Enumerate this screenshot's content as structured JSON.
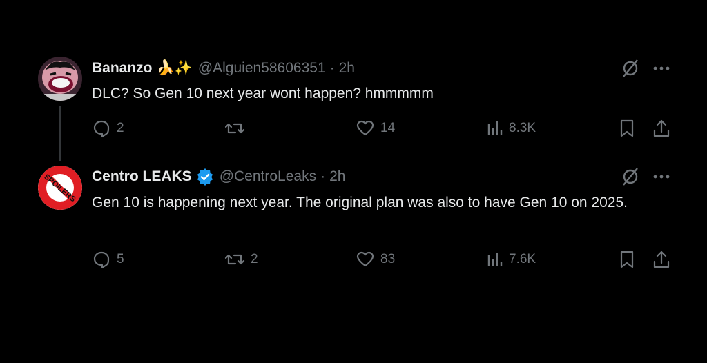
{
  "tweets": [
    {
      "name": "Bananzo",
      "emoji": "🍌✨",
      "handle": "@Alguien58606351",
      "separator": "·",
      "time": "2h",
      "text": "DLC? So Gen 10 next year wont happen? hmmmmm",
      "replies": "2",
      "reposts": "",
      "likes": "14",
      "views": "8.3K"
    },
    {
      "name": "Centro LEAKS",
      "verified": true,
      "handle": "@CentroLeaks",
      "separator": "·",
      "time": "2h",
      "text": "Gen 10 is happening next year. The original plan was also to have Gen 10 on 2025.",
      "replies": "5",
      "reposts": "2",
      "likes": "83",
      "views": "7.6K",
      "avatar_text": "SPOILERS"
    }
  ],
  "colors": {
    "background": "#000000",
    "text": "#e7e9ea",
    "muted": "#71767b",
    "verified": "#1d9bf0",
    "thread_line": "#333639"
  },
  "icons": [
    "grok-icon",
    "more-icon",
    "reply-icon",
    "repost-icon",
    "like-icon",
    "views-icon",
    "bookmark-icon",
    "share-icon",
    "verified-badge-icon"
  ]
}
